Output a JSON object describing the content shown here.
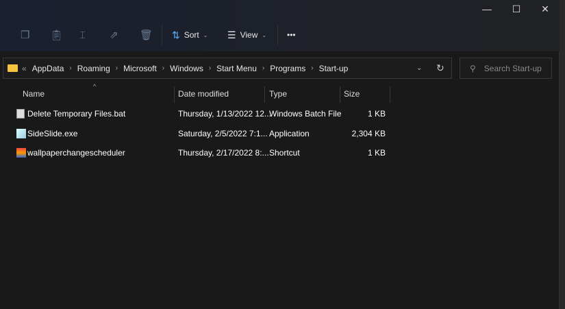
{
  "toolbar": {
    "sort": "Sort",
    "view": "View",
    "more": "•••"
  },
  "address": {
    "crumbs": [
      "AppData",
      "Roaming",
      "Microsoft",
      "Windows",
      "Start Menu",
      "Programs",
      "Start-up"
    ],
    "overflow": "«"
  },
  "search": {
    "placeholder": "Search Start-up"
  },
  "columns": {
    "name": "Name",
    "date": "Date modified",
    "type": "Type",
    "size": "Size"
  },
  "files": [
    {
      "name": "Delete Temporary Files.bat",
      "date": "Thursday, 1/13/2022 12...",
      "type": "Windows Batch File",
      "size": "1 KB",
      "icon": "batch-file-icon"
    },
    {
      "name": "SideSlide.exe",
      "date": "Saturday, 2/5/2022 7:1...",
      "type": "Application",
      "size": "2,304 KB",
      "icon": "application-icon"
    },
    {
      "name": "wallpaperchangescheduler",
      "date": "Thursday, 2/17/2022 8:...",
      "type": "Shortcut",
      "size": "1 KB",
      "icon": "shortcut-icon"
    }
  ]
}
